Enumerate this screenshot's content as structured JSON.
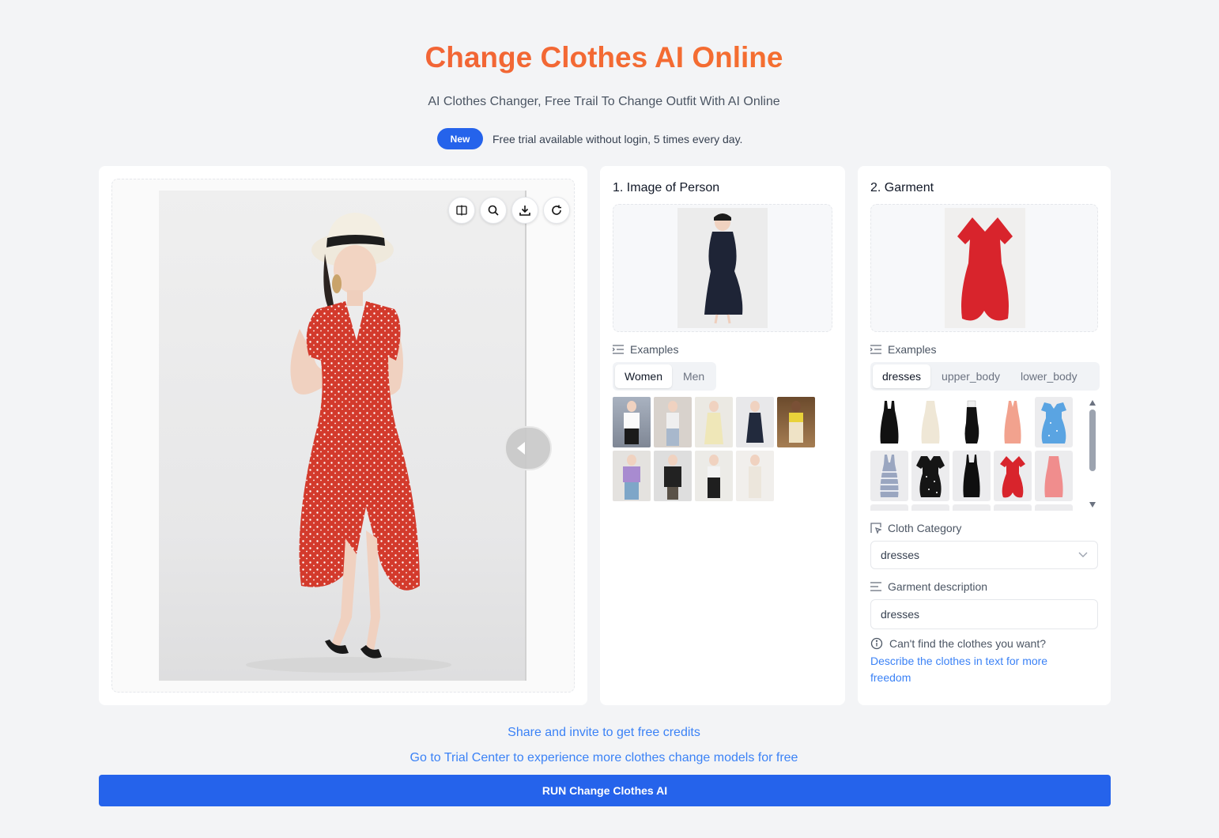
{
  "header": {
    "title": "Change Clothes AI Online",
    "subtitle": "AI Clothes Changer, Free Trail To Change Outfit With AI Online",
    "badge": "New",
    "notice": "Free trial available without login, 5 times every day."
  },
  "result": {
    "tools": [
      "compare-icon",
      "zoom-icon",
      "download-icon",
      "refresh-icon"
    ]
  },
  "person": {
    "title": "1. Image of Person",
    "examples_label": "Examples",
    "tabs": [
      "Women",
      "Men"
    ],
    "active_tab": "Women"
  },
  "garment": {
    "title": "2. Garment",
    "examples_label": "Examples",
    "tabs": [
      "dresses",
      "upper_body",
      "lower_body"
    ],
    "active_tab": "dresses",
    "category_label": "Cloth Category",
    "category_value": "dresses",
    "description_label": "Garment description",
    "description_value": "dresses",
    "hint": "Can't find the clothes you want?",
    "hint_link": "Describe the clothes in text for more freedom"
  },
  "footer": {
    "share_link": "Share and invite to get free credits",
    "trial_link": "Go to Trial Center to experience more clothes change models for free",
    "run_button": "RUN Change Clothes AI"
  },
  "colors": {
    "primary": "#2563eb",
    "title_gradient_start": "#ef5a3c",
    "title_gradient_end": "#f7792a",
    "link": "#3b82f6"
  }
}
